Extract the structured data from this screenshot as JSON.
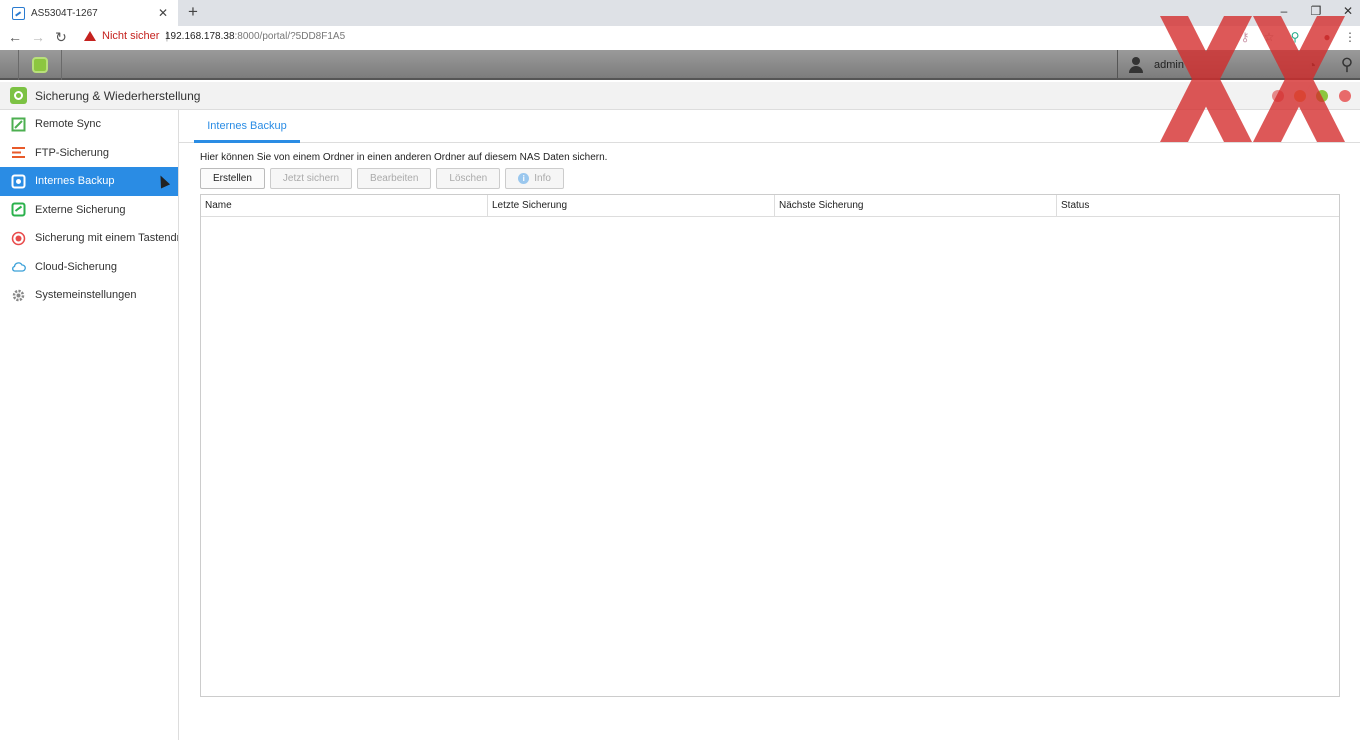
{
  "browser": {
    "tab_title": "AS5304T-1267",
    "url_host": "192.168.178.38",
    "url_rest": ":8000/portal/?5DD8F1A5",
    "security_label": "Nicht sicher"
  },
  "nas": {
    "username": "admin"
  },
  "app": {
    "title": "Sicherung & Wiederherstellung"
  },
  "sidebar": {
    "items": [
      {
        "label": "Remote Sync",
        "icon": "sync-icon",
        "color": "#4caf50"
      },
      {
        "label": "FTP-Sicherung",
        "icon": "ftp-icon",
        "color": "#e85a2a"
      },
      {
        "label": "Internes Backup",
        "icon": "internal-backup-icon",
        "color": "#ffffff",
        "active": true
      },
      {
        "label": "Externe Sicherung",
        "icon": "external-backup-icon",
        "color": "#2bb24c"
      },
      {
        "label": "Sicherung mit einem Tastendruck",
        "icon": "one-touch-icon",
        "color": "#e84a4a"
      },
      {
        "label": "Cloud-Sicherung",
        "icon": "cloud-icon",
        "color": "#3aa0d8"
      },
      {
        "label": "Systemeinstellungen",
        "icon": "gear-icon",
        "color": "#888888"
      }
    ]
  },
  "content": {
    "tab": "Internes Backup",
    "description": "Hier können Sie von einem Ordner in einen anderen Ordner auf diesem NAS Daten sichern.",
    "buttons": {
      "create": "Erstellen",
      "backup_now": "Jetzt sichern",
      "edit": "Bearbeiten",
      "delete": "Löschen",
      "info": "Info"
    },
    "columns": [
      "Name",
      "Letzte Sicherung",
      "Nächste Sicherung",
      "Status"
    ]
  },
  "colors": {
    "accent": "#2a8ce4",
    "app_green": "#7cc243"
  }
}
